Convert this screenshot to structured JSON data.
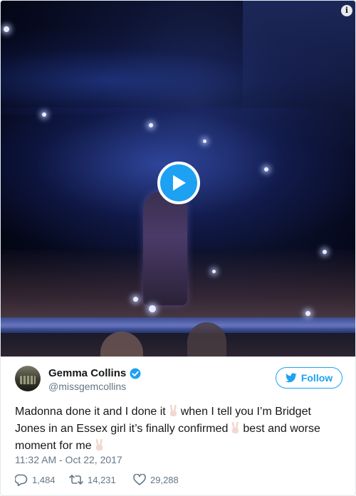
{
  "media": {
    "type": "video",
    "play_icon": "play-icon",
    "info_icon_glyph": "i"
  },
  "user": {
    "display_name": "Gemma Collins",
    "handle": "@missgemcollins",
    "verified": true,
    "avatar_icon": "avatar-photo"
  },
  "follow_button": {
    "label": "Follow",
    "icon": "twitter-bird-icon"
  },
  "tweet": {
    "segments": [
      "Madonna done it and I done it",
      "when I tell you I’m Bridget Jones in an Essex girl it’s finally confirmed",
      "best and worse moment for me"
    ],
    "emoji_name": "victory-hand-emoji"
  },
  "timestamp": "11:32 AM - Oct 22, 2017",
  "actions": {
    "replies": "1,484",
    "retweets": "14,231",
    "likes": "29,288"
  },
  "colors": {
    "accent": "#1da1f2",
    "secondary_text": "#657786",
    "primary_text": "#14171a"
  }
}
